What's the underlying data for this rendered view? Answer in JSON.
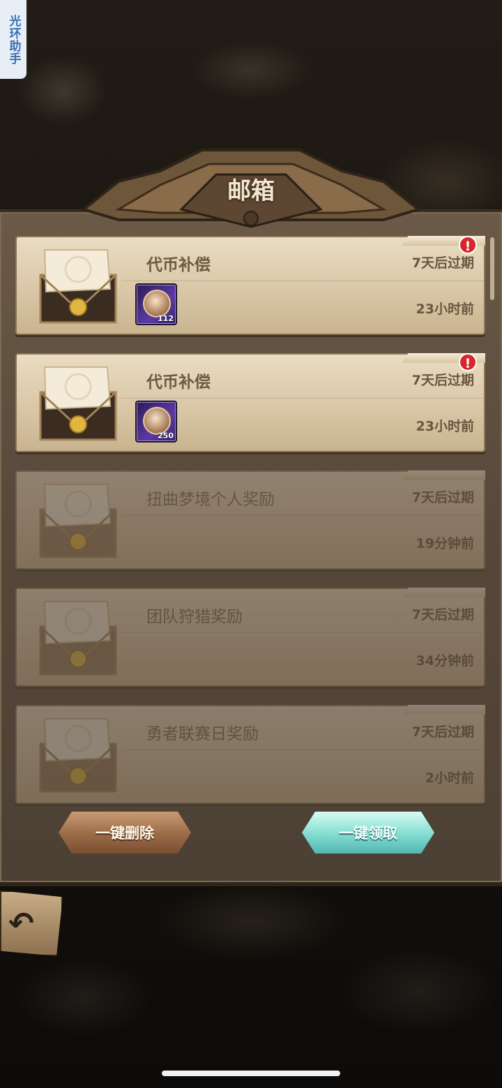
{
  "side_tab": {
    "label": "光环助手"
  },
  "header": {
    "title": "邮箱"
  },
  "mails": [
    {
      "title": "代币补偿",
      "expire": "7天后过期",
      "time": "23小时前",
      "unread": true,
      "reward_count": "112",
      "reward_icon": "clover-coin-icon"
    },
    {
      "title": "代币补偿",
      "expire": "7天后过期",
      "time": "23小时前",
      "unread": true,
      "reward_count": "250",
      "reward_icon": "clover-coin-icon"
    },
    {
      "title": "扭曲梦境个人奖励",
      "expire": "7天后过期",
      "time": "19分钟前",
      "unread": false
    },
    {
      "title": "团队狩猎奖励",
      "expire": "7天后过期",
      "time": "34分钟前",
      "unread": false
    },
    {
      "title": "勇者联赛日奖励",
      "expire": "7天后过期",
      "time": "2小时前",
      "unread": false
    }
  ],
  "buttons": {
    "delete_all": "一键删除",
    "claim_all": "一键领取"
  },
  "alert_glyph": "!",
  "back_glyph": "↶",
  "colors": {
    "claim_accent": "#8fe3d7",
    "delete_accent": "#9b6b47",
    "alert": "#d9262a"
  }
}
